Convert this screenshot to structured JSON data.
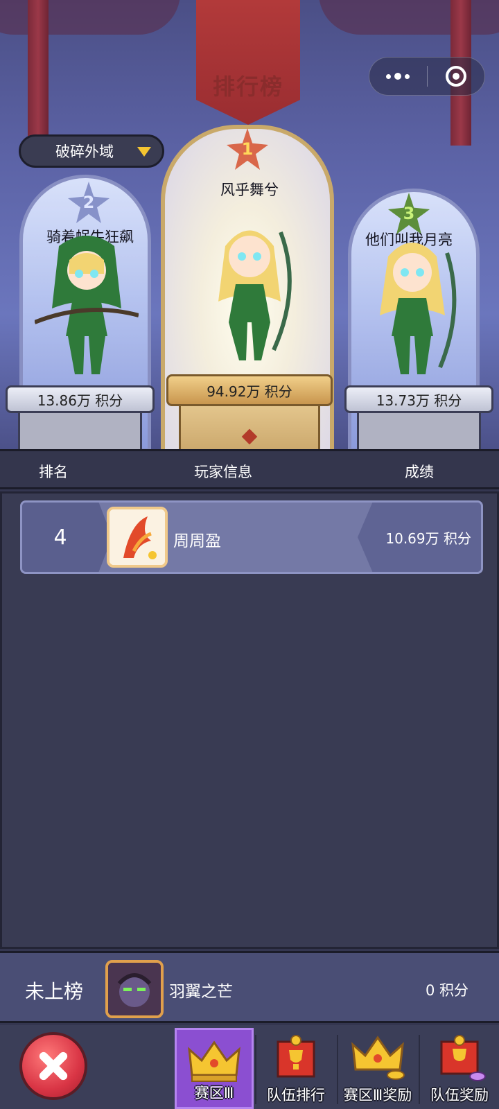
{
  "header": {
    "title": "排行榜",
    "region_selector": "破碎外域"
  },
  "podium": [
    {
      "rank": "1",
      "name": "风乎舞兮",
      "score": "94.92万 积分"
    },
    {
      "rank": "2",
      "name": "骑着蜗牛狂飙",
      "score": "13.86万 积分"
    },
    {
      "rank": "3",
      "name": "他们叫我月亮",
      "score": "13.73万 积分"
    }
  ],
  "table_header": {
    "rank": "排名",
    "player": "玩家信息",
    "score": "成绩"
  },
  "rows": [
    {
      "rank": "4",
      "name": "周周盈",
      "score": "10.69万 积分"
    }
  ],
  "self": {
    "status": "未上榜",
    "name": "羽翼之芒",
    "score": "0 积分"
  },
  "nav": {
    "tabs": [
      "赛区Ⅲ",
      "队伍排行",
      "赛区Ⅲ奖励",
      "队伍奖励"
    ],
    "active": "赛区Ⅲ"
  },
  "colors": {
    "active_tab": "#8b4fd1",
    "close_button": "#d93545",
    "gold_accent": "#c9964e",
    "list_background": "#393b53"
  }
}
